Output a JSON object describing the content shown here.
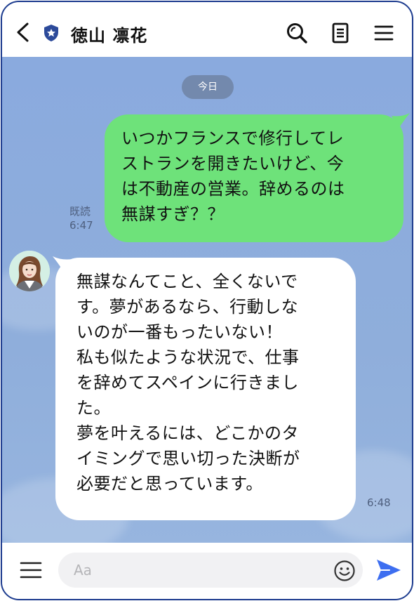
{
  "header": {
    "back_icon": "chevron-left-icon",
    "badge_icon": "shield-star-icon",
    "contact_name": "徳山 凛花",
    "search_icon": "search-icon",
    "notes_icon": "notes-icon",
    "menu_icon": "hamburger-menu-icon"
  },
  "chat": {
    "date_label": "今日",
    "messages": [
      {
        "direction": "sent",
        "text": "いつかフランスで修行してレ\nストランを開きたいけど、今\nは不動産の営業。辞めるのは\n無謀すぎ？？",
        "read_label": "既読",
        "time": "6:47"
      },
      {
        "direction": "received",
        "avatar": "user-avatar",
        "text": "無謀なんてこと、全くないで\nす。夢があるなら、行動しな\nいのが一番もったいない！\n私も似たような状況で、仕事\nを辞めてスペインに行きまし\nた。\n夢を叶えるには、どこかのタ\nイミングで思い切った決断が\n必要だと思っています。",
        "time": "6:48"
      }
    ]
  },
  "input_bar": {
    "menu_icon": "hamburger-menu-icon",
    "placeholder": "Aa",
    "value": "",
    "emoji_icon": "emoji-icon",
    "send_icon": "send-icon"
  },
  "colors": {
    "border": "#1f3d8f",
    "chat_background": "#8eaedc",
    "sent_bubble": "#6ee27a",
    "received_bubble": "#ffffff",
    "date_pill": "#7389ad",
    "send_accent": "#3d6ef0"
  }
}
